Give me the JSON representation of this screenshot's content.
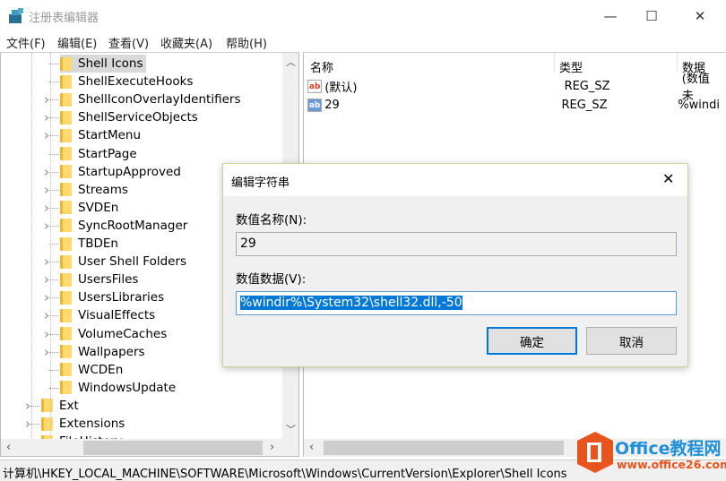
{
  "window": {
    "title": "注册表编辑器",
    "icon": "regedit-icon"
  },
  "menu": [
    "文件(F)",
    "编辑(E)",
    "查看(V)",
    "收藏夹(A)",
    "帮助(H)"
  ],
  "tree": {
    "items": [
      {
        "label": "Shell Icons",
        "level": 2,
        "expandable": false,
        "selected": true
      },
      {
        "label": "ShellExecuteHooks",
        "level": 2,
        "expandable": false
      },
      {
        "label": "ShellIconOverlayIdentifiers",
        "level": 2,
        "expandable": true
      },
      {
        "label": "ShellServiceObjects",
        "level": 2,
        "expandable": true
      },
      {
        "label": "StartMenu",
        "level": 2,
        "expandable": true
      },
      {
        "label": "StartPage",
        "level": 2,
        "expandable": false
      },
      {
        "label": "StartupApproved",
        "level": 2,
        "expandable": true
      },
      {
        "label": "Streams",
        "level": 2,
        "expandable": true
      },
      {
        "label": "SVDEn",
        "level": 2,
        "expandable": true
      },
      {
        "label": "SyncRootManager",
        "level": 2,
        "expandable": true
      },
      {
        "label": "TBDEn",
        "level": 2,
        "expandable": false
      },
      {
        "label": "User Shell Folders",
        "level": 2,
        "expandable": true
      },
      {
        "label": "UsersFiles",
        "level": 2,
        "expandable": true
      },
      {
        "label": "UsersLibraries",
        "level": 2,
        "expandable": true
      },
      {
        "label": "VisualEffects",
        "level": 2,
        "expandable": true
      },
      {
        "label": "VolumeCaches",
        "level": 2,
        "expandable": true
      },
      {
        "label": "Wallpapers",
        "level": 2,
        "expandable": true
      },
      {
        "label": "WCDEn",
        "level": 2,
        "expandable": false
      },
      {
        "label": "WindowsUpdate",
        "level": 2,
        "expandable": false
      },
      {
        "label": "Ext",
        "level": 1,
        "expandable": true
      },
      {
        "label": "Extensions",
        "level": 1,
        "expandable": true
      },
      {
        "label": "FileHistory",
        "level": 1,
        "expandable": true
      }
    ]
  },
  "list": {
    "columns": [
      "名称",
      "类型",
      "数据"
    ],
    "rows": [
      {
        "name": "(默认)",
        "type": "REG_SZ",
        "data": "(数值未",
        "icon": "string-value-icon"
      },
      {
        "name": "29",
        "type": "REG_SZ",
        "data": "%windi",
        "icon": "string-value-icon"
      }
    ]
  },
  "status": "计算机\\HKEY_LOCAL_MACHINE\\SOFTWARE\\Microsoft\\Windows\\CurrentVersion\\Explorer\\Shell Icons",
  "dialog": {
    "title": "编辑字符串",
    "name_label": "数值名称(N):",
    "name_value": "29",
    "data_label": "数值数据(V):",
    "data_value": "%windir%\\System32\\shell32.dll,-50",
    "ok": "确定",
    "cancel": "取消"
  },
  "watermark": {
    "brand": "Office教程网",
    "url": "www.office26.com"
  },
  "colors": {
    "selection": "#0078d7",
    "dialog_border": "#d4d29a",
    "folder": "#ffd96b",
    "watermark": "#e8541e"
  }
}
